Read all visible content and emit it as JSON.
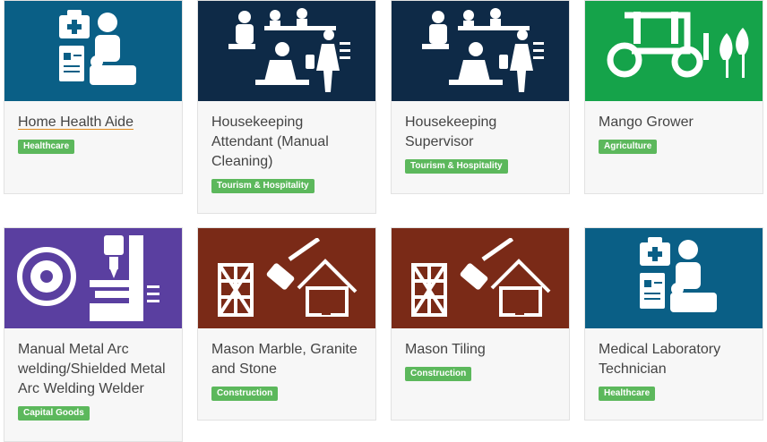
{
  "cards": [
    {
      "title": "Home Health Aide",
      "tag": "Healthcare",
      "color": "#0a5f86",
      "icon": "healthcare-icon"
    },
    {
      "title": "Housekeeping Attendant (Manual Cleaning)",
      "tag": "Tourism & Hospitality",
      "color": "#0e2a47",
      "icon": "hospitality-icon"
    },
    {
      "title": "Housekeeping Supervisor",
      "tag": "Tourism & Hospitality",
      "color": "#0e2a47",
      "icon": "hospitality-icon"
    },
    {
      "title": "Mango Grower",
      "tag": "Agriculture",
      "color": "#15a34a",
      "icon": "tractor-icon"
    },
    {
      "title": "Manual Metal Arc welding/Shielded Metal Arc Welding Welder",
      "tag": "Capital Goods",
      "color": "#5a3fa0",
      "icon": "machine-icon"
    },
    {
      "title": "Mason Marble, Granite and Stone",
      "tag": "Construction",
      "color": "#7a2a17",
      "icon": "construction-icon"
    },
    {
      "title": "Mason Tiling",
      "tag": "Construction",
      "color": "#7a2a17",
      "icon": "construction-icon"
    },
    {
      "title": "Medical Laboratory Technician",
      "tag": "Healthcare",
      "color": "#0a5f86",
      "icon": "healthcare-icon"
    }
  ],
  "badge_color": "#5cb85c"
}
